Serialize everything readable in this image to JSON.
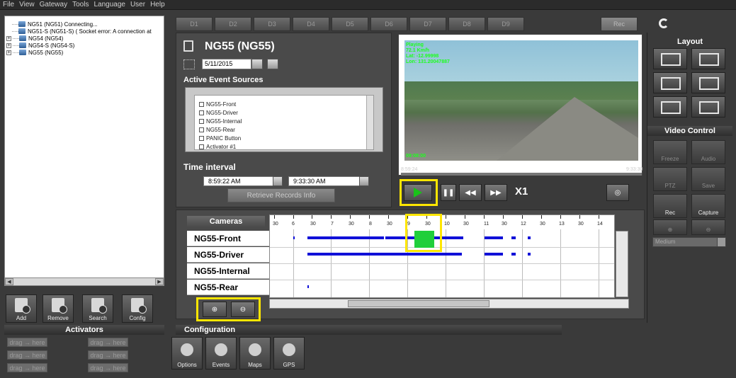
{
  "menu": [
    "File",
    "View",
    "Gateway",
    "Tools",
    "Language",
    "User",
    "Help"
  ],
  "tree": [
    {
      "label": "NG51 (NG51) Connecting...",
      "expand": false
    },
    {
      "label": "NG51-S (NG51-S) ( Socket error: A connection at",
      "expand": false
    },
    {
      "label": "NG54 (NG54)",
      "expand": true
    },
    {
      "label": "NG54-S (NG54-S)",
      "expand": true
    },
    {
      "label": "NG55 (NG55)",
      "expand": true
    }
  ],
  "left_buttons": [
    "Add",
    "Remove",
    "Search",
    "Config"
  ],
  "activators": {
    "title": "Activators",
    "drag_label": "drag → here"
  },
  "tabs": [
    "D1",
    "D2",
    "D3",
    "D4",
    "D5",
    "D6",
    "D7",
    "D8",
    "D9",
    "Rec"
  ],
  "device": {
    "title": "NG55 (NG55)",
    "date": "5/11/2015",
    "event_sources_title": "Active Event Sources",
    "event_sources": [
      "NG55-Front",
      "NG55-Driver",
      "NG55-Internal",
      "NG55-Rear",
      "PANIC Button",
      "Activator #1"
    ],
    "time_interval_title": "Time interval",
    "time_from": "8:59:22 AM",
    "time_to": "9:33:30 AM",
    "retrieve_label": "Retrieve Records Info"
  },
  "video": {
    "overlay": [
      "Playing",
      "72.1 Km/h",
      "Lat: -12.99998",
      "Lon: 131.20047887"
    ],
    "bottom_overlay": "09:08:00",
    "start_time": "8:59:24",
    "end_time": "9:33:30",
    "speed": "X1"
  },
  "timeline": {
    "header": "Cameras",
    "cameras": [
      "NG55-Front",
      "NG55-Driver",
      "NG55-Internal",
      "NG55-Rear"
    ],
    "tick_labels": [
      "30",
      "6",
      "30",
      "7",
      "30",
      "8",
      "30",
      "9",
      "30",
      "10",
      "30",
      "11",
      "30",
      "12",
      "30",
      "13",
      "30",
      "14"
    ]
  },
  "right": {
    "layout_title": "Layout",
    "video_control_title": "Video Control",
    "controls": [
      "Freeze",
      "Audio",
      "PTZ",
      "Save",
      "Rec",
      "Capture"
    ],
    "quality": "Medium"
  },
  "config": {
    "title": "Configuration",
    "buttons": [
      "Options",
      "Events",
      "Maps",
      "GPS"
    ]
  }
}
